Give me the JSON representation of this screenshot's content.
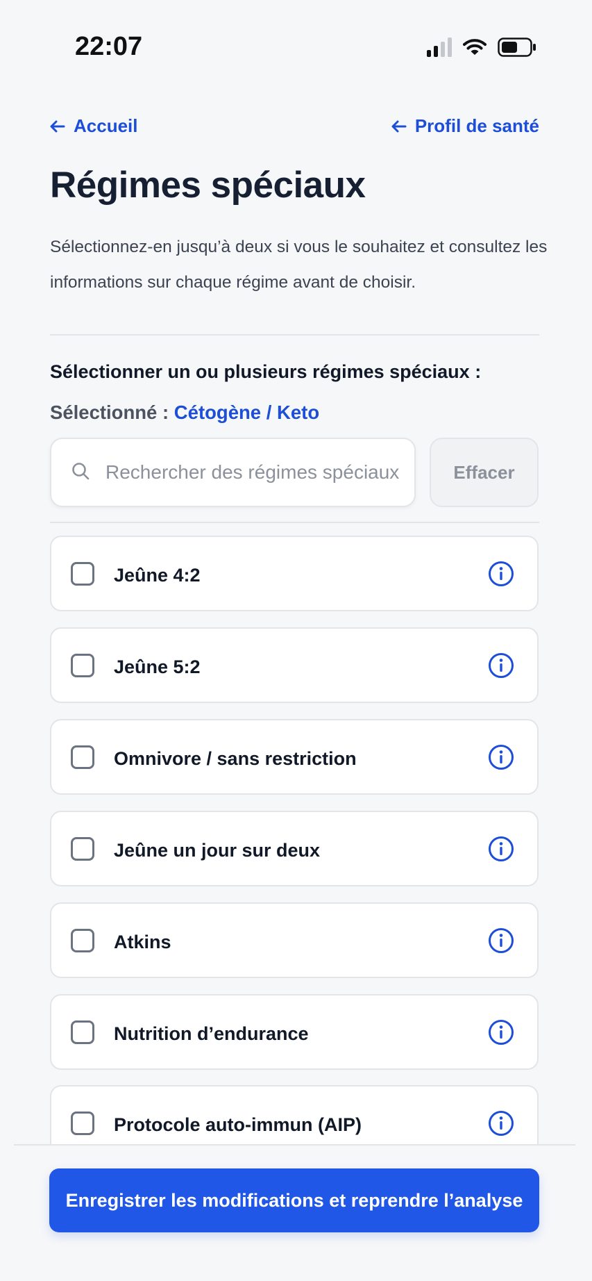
{
  "status_bar": {
    "time": "22:07"
  },
  "nav": {
    "back_label": "Accueil",
    "profile_label": "Profil de santé"
  },
  "page": {
    "title": "Régimes spéciaux",
    "intro": "Sélectionnez-en jusqu’à deux si vous le souhaitez et consultez les informations sur chaque régime avant de choisir."
  },
  "selection": {
    "heading": "Sélectionner un ou plusieurs régimes spéciaux :",
    "selected_prefix": "Sélectionné : ",
    "selected_value": "Cétogène / Keto"
  },
  "search": {
    "placeholder": "Rechercher des régimes spéciaux",
    "value": "",
    "clear_label": "Effacer"
  },
  "diets": [
    {
      "label": "Jeûne 4:2",
      "checked": false
    },
    {
      "label": "Jeûne 5:2",
      "checked": false
    },
    {
      "label": "Omnivore / sans restriction",
      "checked": false
    },
    {
      "label": "Jeûne un jour sur deux",
      "checked": false
    },
    {
      "label": "Atkins",
      "checked": false
    },
    {
      "label": "Nutrition d’endurance",
      "checked": false
    },
    {
      "label": "Protocole auto-immun (AIP)",
      "checked": false
    }
  ],
  "footer": {
    "save_label": "Enregistrer les modifications et reprendre l’analyse"
  },
  "colors": {
    "accent": "#1d4ed8",
    "primary_button": "#2157e6",
    "background": "#f6f7f9",
    "border": "#e3e5e9"
  }
}
